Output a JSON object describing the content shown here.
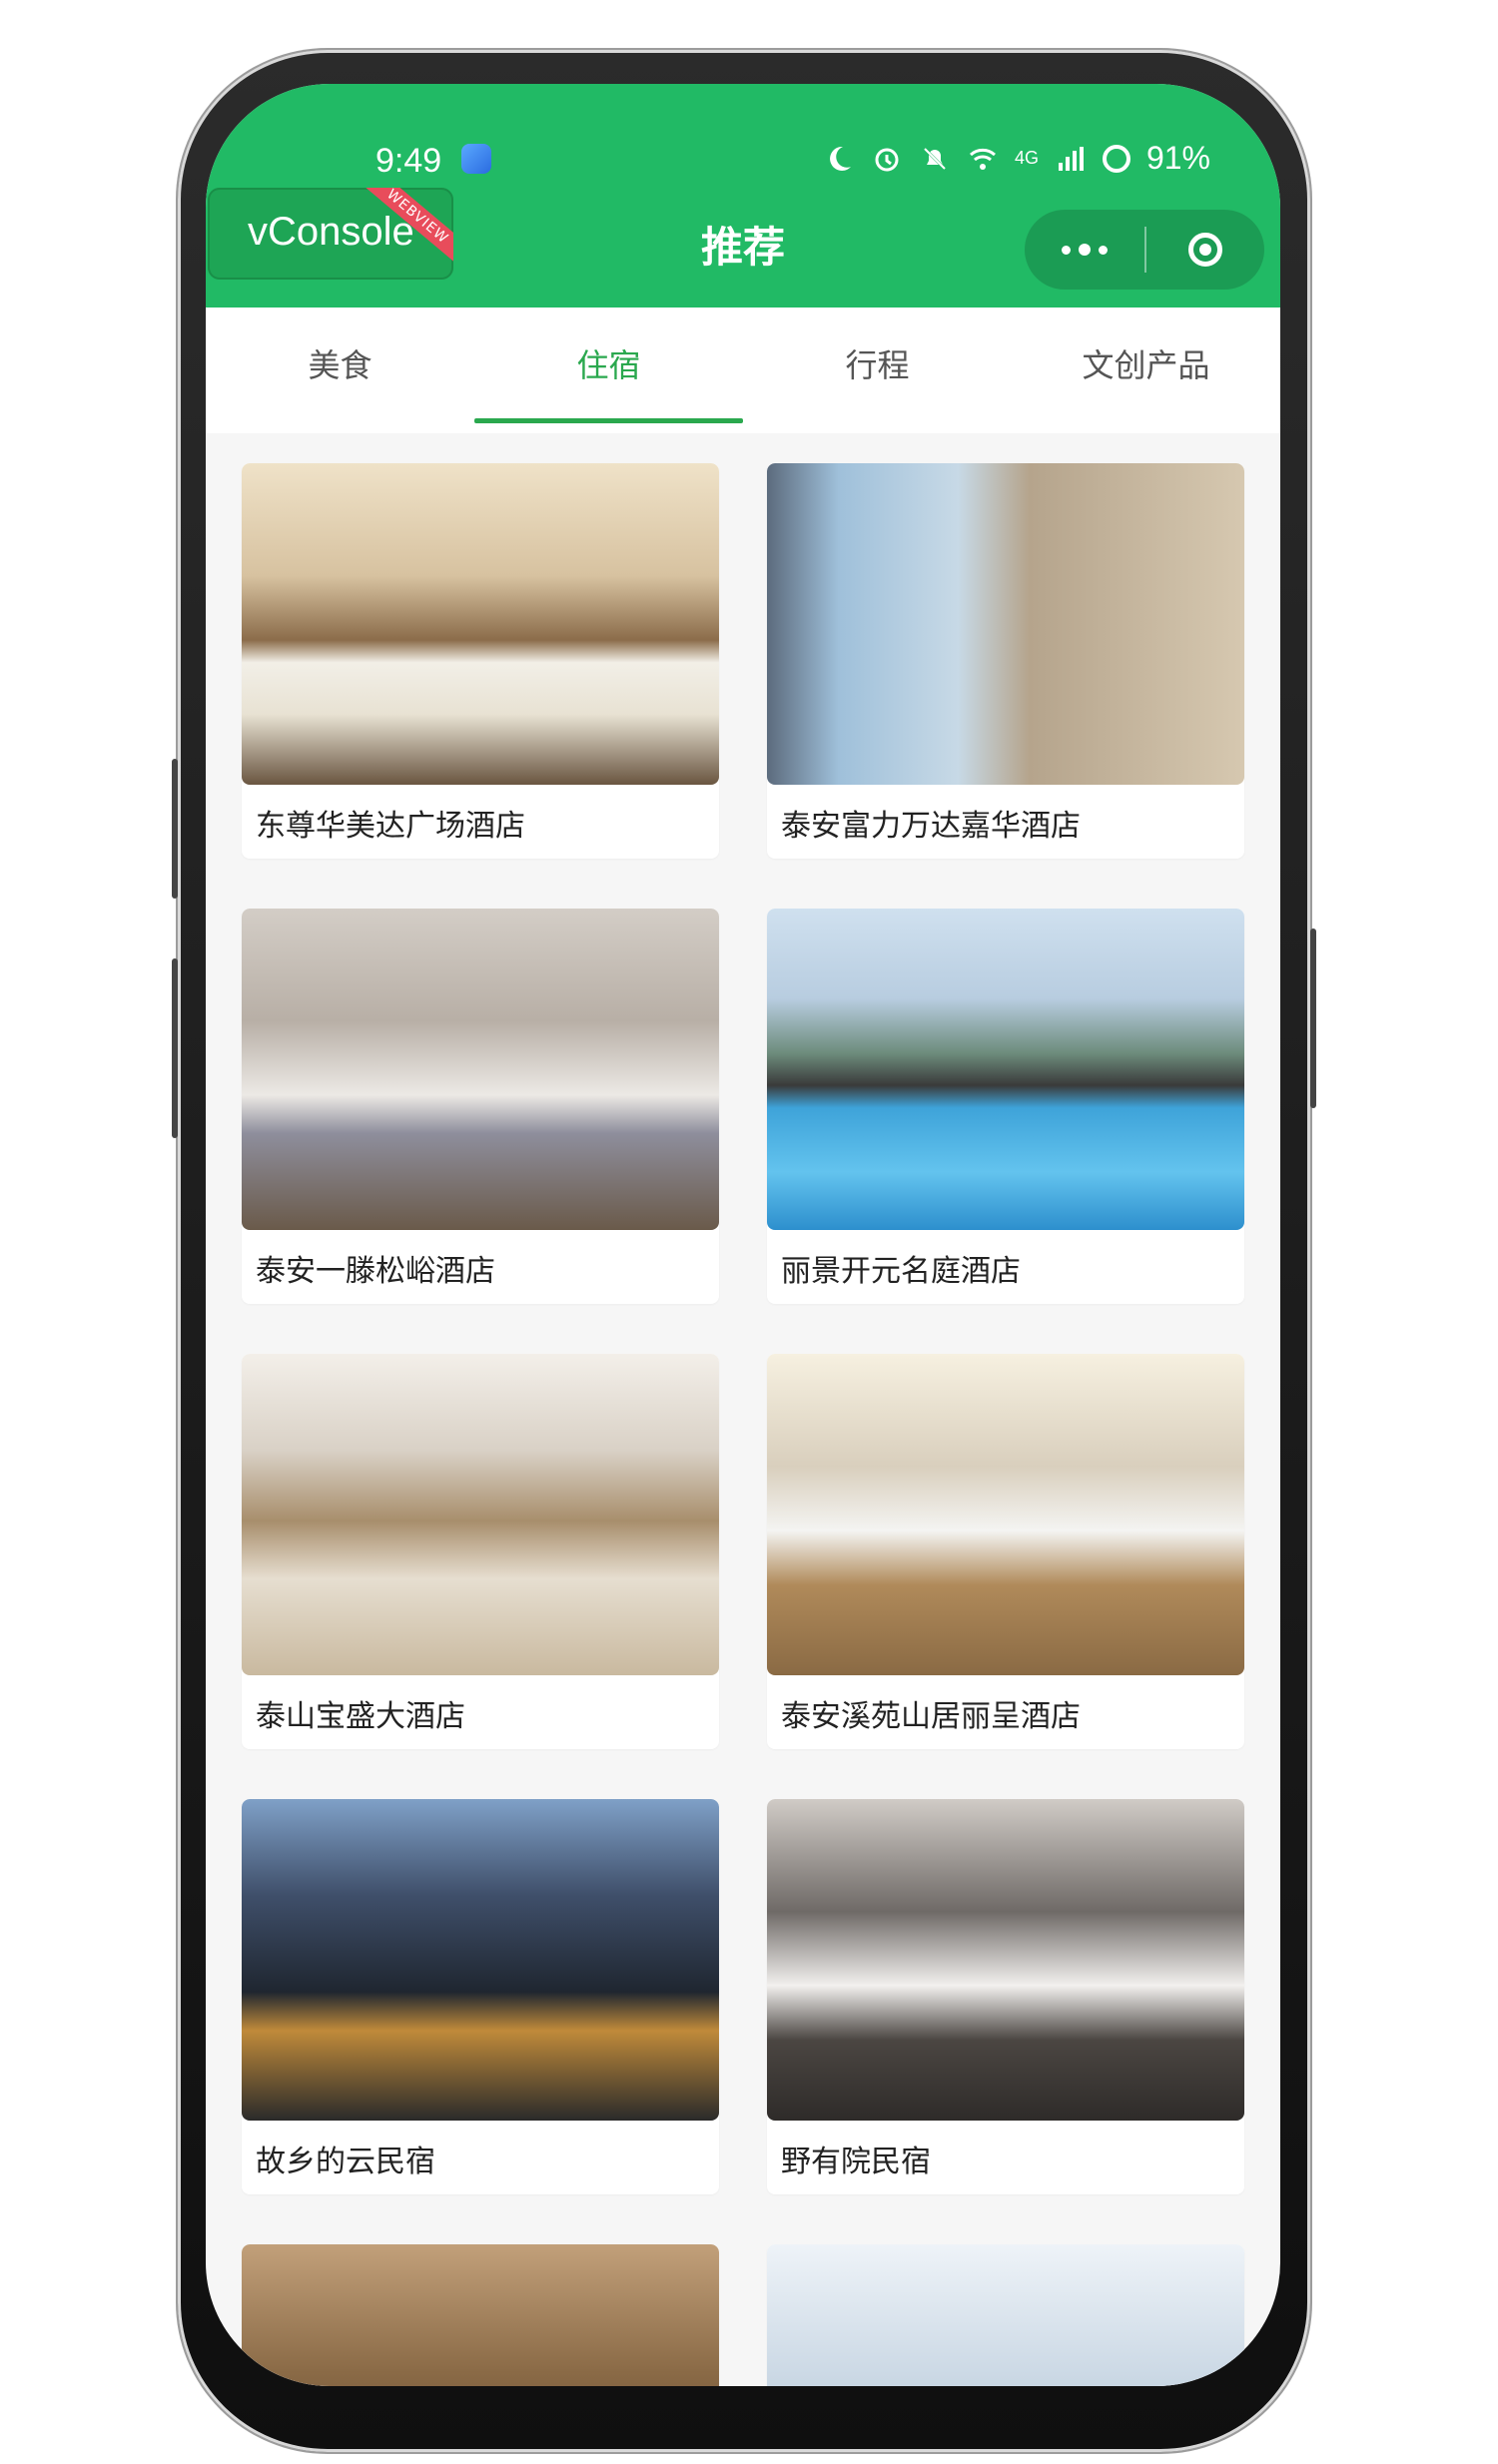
{
  "status_bar": {
    "time": "9:49",
    "network": "4G",
    "battery": "91%"
  },
  "debug": {
    "vconsole_label": "vConsole",
    "ribbon_label": "WEBVIEW"
  },
  "nav": {
    "title": "推荐"
  },
  "tabs": [
    {
      "label": "美食"
    },
    {
      "label": "住宿"
    },
    {
      "label": "行程"
    },
    {
      "label": "文创产品"
    }
  ],
  "active_tab": "住宿",
  "colors": {
    "brand_green": "#21ba65",
    "tab_active": "#2aa84e"
  },
  "hotels": [
    {
      "name": "东尊华美达广场酒店",
      "image": "hotel-room-warm"
    },
    {
      "name": "泰安富力万达嘉华酒店",
      "image": "hotel-room-window"
    },
    {
      "name": "泰安一滕松峪酒店",
      "image": "hotel-room-grey"
    },
    {
      "name": "丽景开元名庭酒店",
      "image": "hotel-pool"
    },
    {
      "name": "泰山宝盛大酒店",
      "image": "hotel-room-view"
    },
    {
      "name": "泰安溪苑山居丽呈酒店",
      "image": "hotel-room-wood"
    },
    {
      "name": "故乡的云民宿",
      "image": "hotel-building"
    },
    {
      "name": "野有院民宿",
      "image": "hotel-room-dark"
    },
    {
      "name": "",
      "image": "hotel-tent"
    },
    {
      "name": "",
      "image": "hotel-sky"
    }
  ]
}
